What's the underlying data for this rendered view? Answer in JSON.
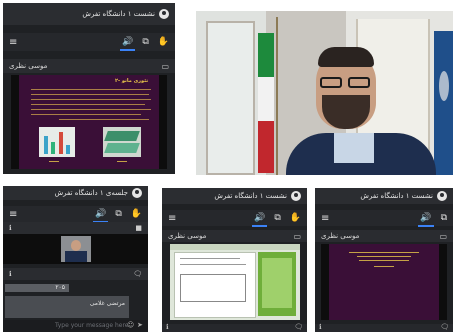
{
  "session_title": "نشست ۱ دانشگاه تفرش",
  "session_title_alt": "جلسه‌ی ۱ دانشگاه تفرش",
  "presenter_name": "موسی نظری",
  "slide_title": "۲- تئوری ماتو",
  "chat": {
    "badge": "۲۰۵",
    "participant_name": "مرتضی غلامی",
    "placeholder": "Type your message here"
  },
  "icons": {
    "menu": "hamburger-icon",
    "audio": "speaker-icon",
    "screen": "screen-share-icon",
    "raise_hand": "hand-icon",
    "user": "user-icon",
    "close": "close-icon",
    "chat": "chat-icon",
    "send": "send-icon",
    "emoji": "emoji-icon"
  },
  "colors": {
    "accent": "#3b82f6",
    "panel": "#1f2124",
    "slide": "#3a0f37"
  }
}
